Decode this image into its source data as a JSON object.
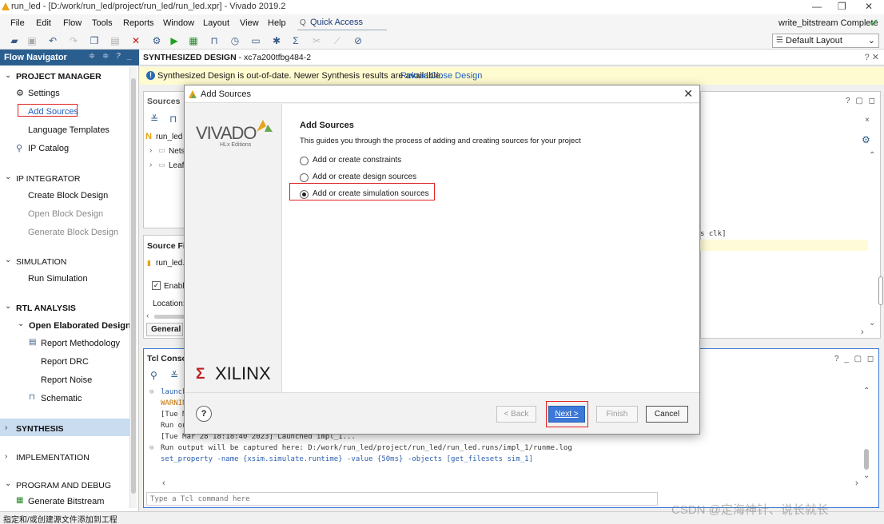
{
  "window": {
    "title": "run_led - [D:/work/run_led/project/run_led/run_led.xpr] - Vivado 2019.2",
    "status_right": "write_bitstream Complete",
    "controls": [
      "—",
      "❐",
      "✕"
    ]
  },
  "menu": {
    "items": [
      "File",
      "Edit",
      "Flow",
      "Tools",
      "Reports",
      "Window",
      "Layout",
      "View",
      "Help"
    ],
    "quick_access": "Quick Access"
  },
  "toolbar": {
    "layout_select": "Default Layout"
  },
  "flow_navigator": {
    "title": "Flow Navigator",
    "header_controls": "≑ ≑ ? _",
    "sections": {
      "project_manager": "PROJECT MANAGER",
      "settings": "Settings",
      "add_sources": "Add Sources",
      "language_templates": "Language Templates",
      "ip_catalog": "IP Catalog",
      "ip_integrator": "IP INTEGRATOR",
      "create_block_design": "Create Block Design",
      "open_block_design": "Open Block Design",
      "generate_block_design": "Generate Block Design",
      "simulation": "SIMULATION",
      "run_simulation": "Run Simulation",
      "rtl_analysis": "RTL ANALYSIS",
      "open_elaborated_design": "Open Elaborated Design",
      "report_methodology": "Report Methodology",
      "report_drc": "Report DRC",
      "report_noise": "Report Noise",
      "schematic": "Schematic",
      "synthesis": "SYNTHESIS",
      "implementation": "IMPLEMENTATION",
      "program_and_debug": "PROGRAM AND DEBUG",
      "generate_bitstream": "Generate Bitstream"
    }
  },
  "main": {
    "header_title": "SYNTHESIZED DESIGN",
    "header_part": " - xc7a200tfbg484-2",
    "header_controls": "? ✕",
    "banner_msg": "Synthesized Design is out-of-date. Newer Synthesis results are available.",
    "banner_reload": "Reload",
    "banner_close": "Close Design",
    "sources": {
      "title": "Sources",
      "controls": "? ▢ ◻",
      "root": "run_led",
      "nets": "Nets",
      "leaf": "Leaf"
    },
    "source_file": {
      "title": "Source File",
      "file": "run_led.",
      "enable": "Enabl",
      "location": "Location:",
      "tab_general": "General"
    },
    "right_panel": {
      "code_fragment": "s clk]"
    },
    "tcl": {
      "title": "Tcl Consol",
      "controls": "? _ ▢ ◻",
      "lines": {
        "l1": "launch_",
        "l2": "WARNING",
        "l3": "[Tue Ma",
        "l4": "Run out",
        "l5": "[Tue Mar 28 18:18:40 2023] Launched impl_1...",
        "l6": "Run output will be captured here: D:/work/run_led/project/run_led/run_led.runs/impl_1/runme.log",
        "l7": "set_property -name {xsim.simulate.runtime} -value {50ms} -objects [get_filesets sim_1]"
      },
      "input_placeholder": "Type a Tcl command here"
    }
  },
  "dialog": {
    "title": "Add Sources",
    "brand_vivado": "VIVADO",
    "brand_edition": "HLx Editions",
    "brand_xilinx": "XILINX",
    "heading": "Add Sources",
    "description": "This guides you through the process of adding and creating sources for your project",
    "options": {
      "constraints": "Add or create constraints",
      "design": "Add or create design sources",
      "simulation": "Add or create simulation sources"
    },
    "selected": "simulation",
    "buttons": {
      "help": "?",
      "back": "< Back",
      "next": "Next >",
      "finish": "Finish",
      "cancel": "Cancel"
    }
  },
  "statusbar": {
    "text": "指定和/或创建源文件添加到工程"
  },
  "watermark": "CSDN @定海神针、说长就长",
  "colors": {
    "nav_header": "#2a5e8f",
    "selection": "#c9dcf0",
    "primary_button": "#3b78d8",
    "highlight_box": "#e02020",
    "banner": "#fffbd0"
  }
}
